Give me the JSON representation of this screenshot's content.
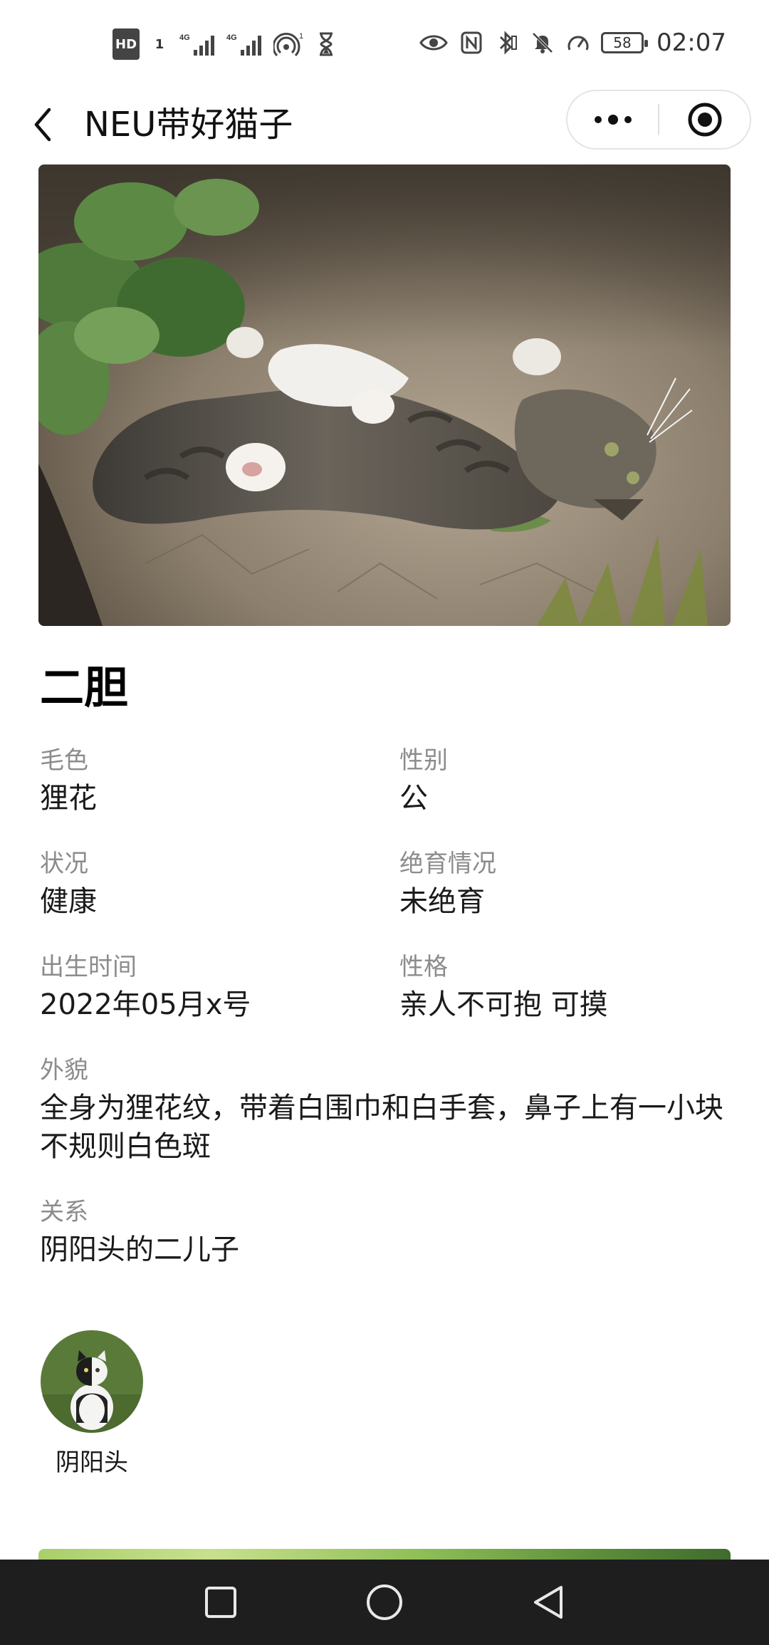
{
  "status_bar": {
    "hd_badge": "HD",
    "sim": "1",
    "net1": "4G",
    "net2": "4G",
    "hotspot_count": "1",
    "battery": "58",
    "time": "02:07"
  },
  "nav": {
    "title": "NEU带好猫子"
  },
  "cat": {
    "name": "二胆"
  },
  "fields": {
    "coat_color": {
      "label": "毛色",
      "value": "狸花"
    },
    "gender": {
      "label": "性别",
      "value": "公"
    },
    "condition": {
      "label": "状况",
      "value": "健康"
    },
    "neutered": {
      "label": "绝育情况",
      "value": "未绝育"
    },
    "birth": {
      "label": "出生时间",
      "value": "2022年05月x号"
    },
    "personality": {
      "label": "性格",
      "value": "亲人不可抱 可摸"
    },
    "appearance": {
      "label": "外貌",
      "value": "全身为狸花纹，带着白围巾和白手套，鼻子上有一小块不规则白色斑"
    },
    "relation": {
      "label": "关系",
      "value": "阴阳头的二儿子"
    }
  },
  "related_cats": [
    {
      "name": "阴阳头"
    }
  ],
  "colors": {
    "label_gray": "#8c8c8c",
    "nav_bg": "#1e1e1e"
  }
}
